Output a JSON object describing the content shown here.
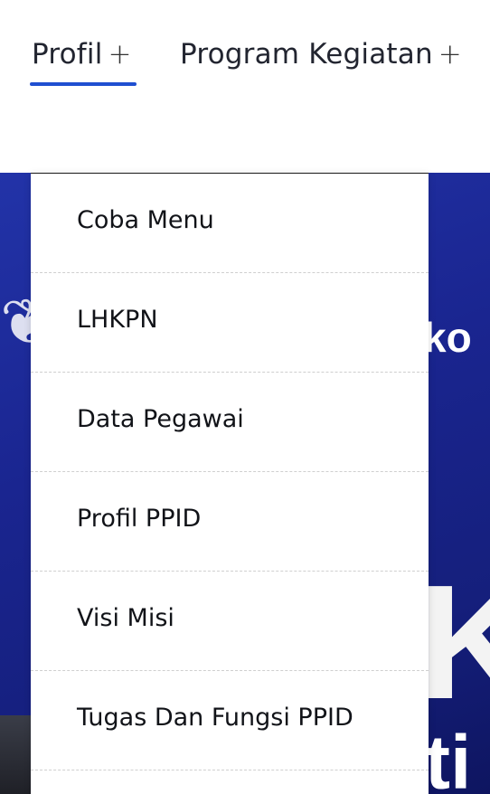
{
  "nav": {
    "items": [
      {
        "label": "Profil",
        "suffix": "+"
      },
      {
        "label": "Program Kegiatan",
        "suffix": "+"
      }
    ],
    "accent": "#1f4fd1"
  },
  "dropdown": {
    "items": [
      {
        "label": "Coba Menu"
      },
      {
        "label": "LHKPN"
      },
      {
        "label": "Data Pegawai"
      },
      {
        "label": "Profil PPID"
      },
      {
        "label": "Visi Misi"
      },
      {
        "label": "Tugas Dan Fungsi PPID"
      }
    ]
  },
  "hero": {
    "fragment_top": "ko",
    "fragment_big": "K",
    "fragment_bottom": "ti",
    "background_color": "#1a2590"
  }
}
